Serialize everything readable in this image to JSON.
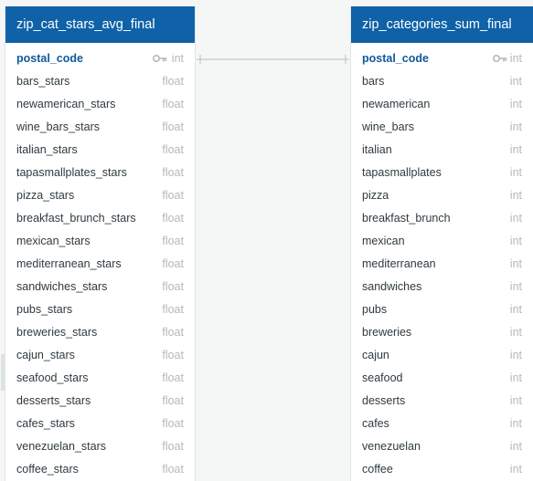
{
  "tables": [
    {
      "id": "table-left",
      "name": "zip_cat_stars_avg_final",
      "columns": [
        {
          "name": "postal_code",
          "type": "int",
          "pk": true
        },
        {
          "name": "bars_stars",
          "type": "float"
        },
        {
          "name": "newamerican_stars",
          "type": "float"
        },
        {
          "name": "wine_bars_stars",
          "type": "float"
        },
        {
          "name": "italian_stars",
          "type": "float"
        },
        {
          "name": "tapasmallplates_stars",
          "type": "float"
        },
        {
          "name": "pizza_stars",
          "type": "float"
        },
        {
          "name": "breakfast_brunch_stars",
          "type": "float"
        },
        {
          "name": "mexican_stars",
          "type": "float"
        },
        {
          "name": "mediterranean_stars",
          "type": "float"
        },
        {
          "name": "sandwiches_stars",
          "type": "float"
        },
        {
          "name": "pubs_stars",
          "type": "float"
        },
        {
          "name": "breweries_stars",
          "type": "float"
        },
        {
          "name": "cajun_stars",
          "type": "float"
        },
        {
          "name": "seafood_stars",
          "type": "float"
        },
        {
          "name": "desserts_stars",
          "type": "float"
        },
        {
          "name": "cafes_stars",
          "type": "float"
        },
        {
          "name": "venezuelan_stars",
          "type": "float"
        },
        {
          "name": "coffee_stars",
          "type": "float"
        }
      ]
    },
    {
      "id": "table-right",
      "name": "zip_categories_sum_final",
      "columns": [
        {
          "name": "postal_code",
          "type": "int",
          "pk": true
        },
        {
          "name": "bars",
          "type": "int"
        },
        {
          "name": "newamerican",
          "type": "int"
        },
        {
          "name": "wine_bars",
          "type": "int"
        },
        {
          "name": "italian",
          "type": "int"
        },
        {
          "name": "tapasmallplates",
          "type": "int"
        },
        {
          "name": "pizza",
          "type": "int"
        },
        {
          "name": "breakfast_brunch",
          "type": "int"
        },
        {
          "name": "mexican",
          "type": "int"
        },
        {
          "name": "mediterranean",
          "type": "int"
        },
        {
          "name": "sandwiches",
          "type": "int"
        },
        {
          "name": "pubs",
          "type": "int"
        },
        {
          "name": "breweries",
          "type": "int"
        },
        {
          "name": "cajun",
          "type": "int"
        },
        {
          "name": "seafood",
          "type": "int"
        },
        {
          "name": "desserts",
          "type": "int"
        },
        {
          "name": "cafes",
          "type": "int"
        },
        {
          "name": "venezuelan",
          "type": "int"
        },
        {
          "name": "coffee",
          "type": "int"
        }
      ]
    }
  ],
  "relationship": {
    "from": "zip_cat_stars_avg_final.postal_code",
    "to": "zip_categories_sum_final.postal_code",
    "cardinality": "one-to-one"
  },
  "colors": {
    "header_bg": "#0f62a8",
    "header_text": "#ffffff",
    "pk_text": "#0f5a9a",
    "column_text": "#2f3a40",
    "type_text": "#b3b9bd",
    "canvas_bg": "#f5f6f6",
    "line": "#b7bdc1"
  },
  "icons": {
    "primary_key": "key-icon"
  }
}
